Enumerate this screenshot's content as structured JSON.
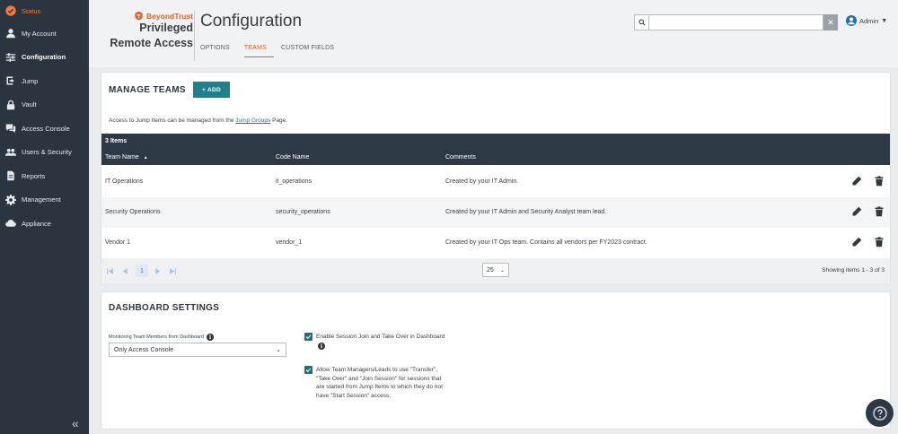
{
  "sidebar": {
    "items": [
      {
        "label": "Status",
        "icon": "check-circle-icon"
      },
      {
        "label": "My Account",
        "icon": "user-icon"
      },
      {
        "label": "Configuration",
        "icon": "sliders-icon"
      },
      {
        "label": "Jump",
        "icon": "jump-icon"
      },
      {
        "label": "Vault",
        "icon": "lock-icon"
      },
      {
        "label": "Access Console",
        "icon": "chat-icon"
      },
      {
        "label": "Users & Security",
        "icon": "users-icon"
      },
      {
        "label": "Reports",
        "icon": "document-icon"
      },
      {
        "label": "Management",
        "icon": "gear-icon"
      },
      {
        "label": "Appliance",
        "icon": "cloud-icon"
      }
    ],
    "active": "Configuration",
    "collapse_glyph": "«"
  },
  "header": {
    "brand_name": "BeyondTrust",
    "product_line1": "Privileged",
    "product_line2": "Remote Access",
    "title": "Configuration",
    "tabs": [
      {
        "label": "OPTIONS"
      },
      {
        "label": "TEAMS"
      },
      {
        "label": "CUSTOM FIELDS"
      }
    ],
    "active_tab": "TEAMS",
    "search": {
      "value": "",
      "placeholder": ""
    },
    "user": "Admin"
  },
  "teams": {
    "title": "MANAGE TEAMS",
    "add_label": "+ ADD",
    "info_prefix": "Access to Jump Items can be managed from the ",
    "info_link": "Jump Groups",
    "info_suffix": " Page.",
    "count": "3 Items",
    "columns": [
      "Team Name",
      "Code Name",
      "Comments"
    ],
    "sort_glyph": "▲",
    "rows": [
      {
        "name": "IT Operations",
        "code": "it_operations",
        "comment": "Created by your IT Admin."
      },
      {
        "name": "Security Operations",
        "code": "security_operations",
        "comment": "Created by your IT Admin and Security Analyst team lead."
      },
      {
        "name": "Vendor 1",
        "code": "vendor_1",
        "comment": "Created by your IT Ops team. Contains all vendors per FY2023 contract."
      }
    ],
    "pager": {
      "current_page": "1",
      "page_size": "25",
      "info": "Showing items 1 - 3 of 3"
    }
  },
  "dashboard": {
    "title": "DASHBOARD SETTINGS",
    "monitor_label": "Monitoring Team Members from Dashboard",
    "monitor_value": "Only Access Console",
    "options": [
      {
        "label": "Enable Session Join and Take Over in Dashboard",
        "checked": true
      },
      {
        "label_lines": [
          "Allow Team Managers/Leads to use \"Transfer\",",
          "\"Take Over\" and \"Join Session\" for sessions that",
          "are started from Jump Items to which they do not",
          "have \"Start Session\" access."
        ],
        "checked": true
      }
    ]
  },
  "colors": {
    "accent": "#ec5a28",
    "teal": "#1f7f8c",
    "sidebar": "#2a3540",
    "table_header": "#2e3946"
  }
}
